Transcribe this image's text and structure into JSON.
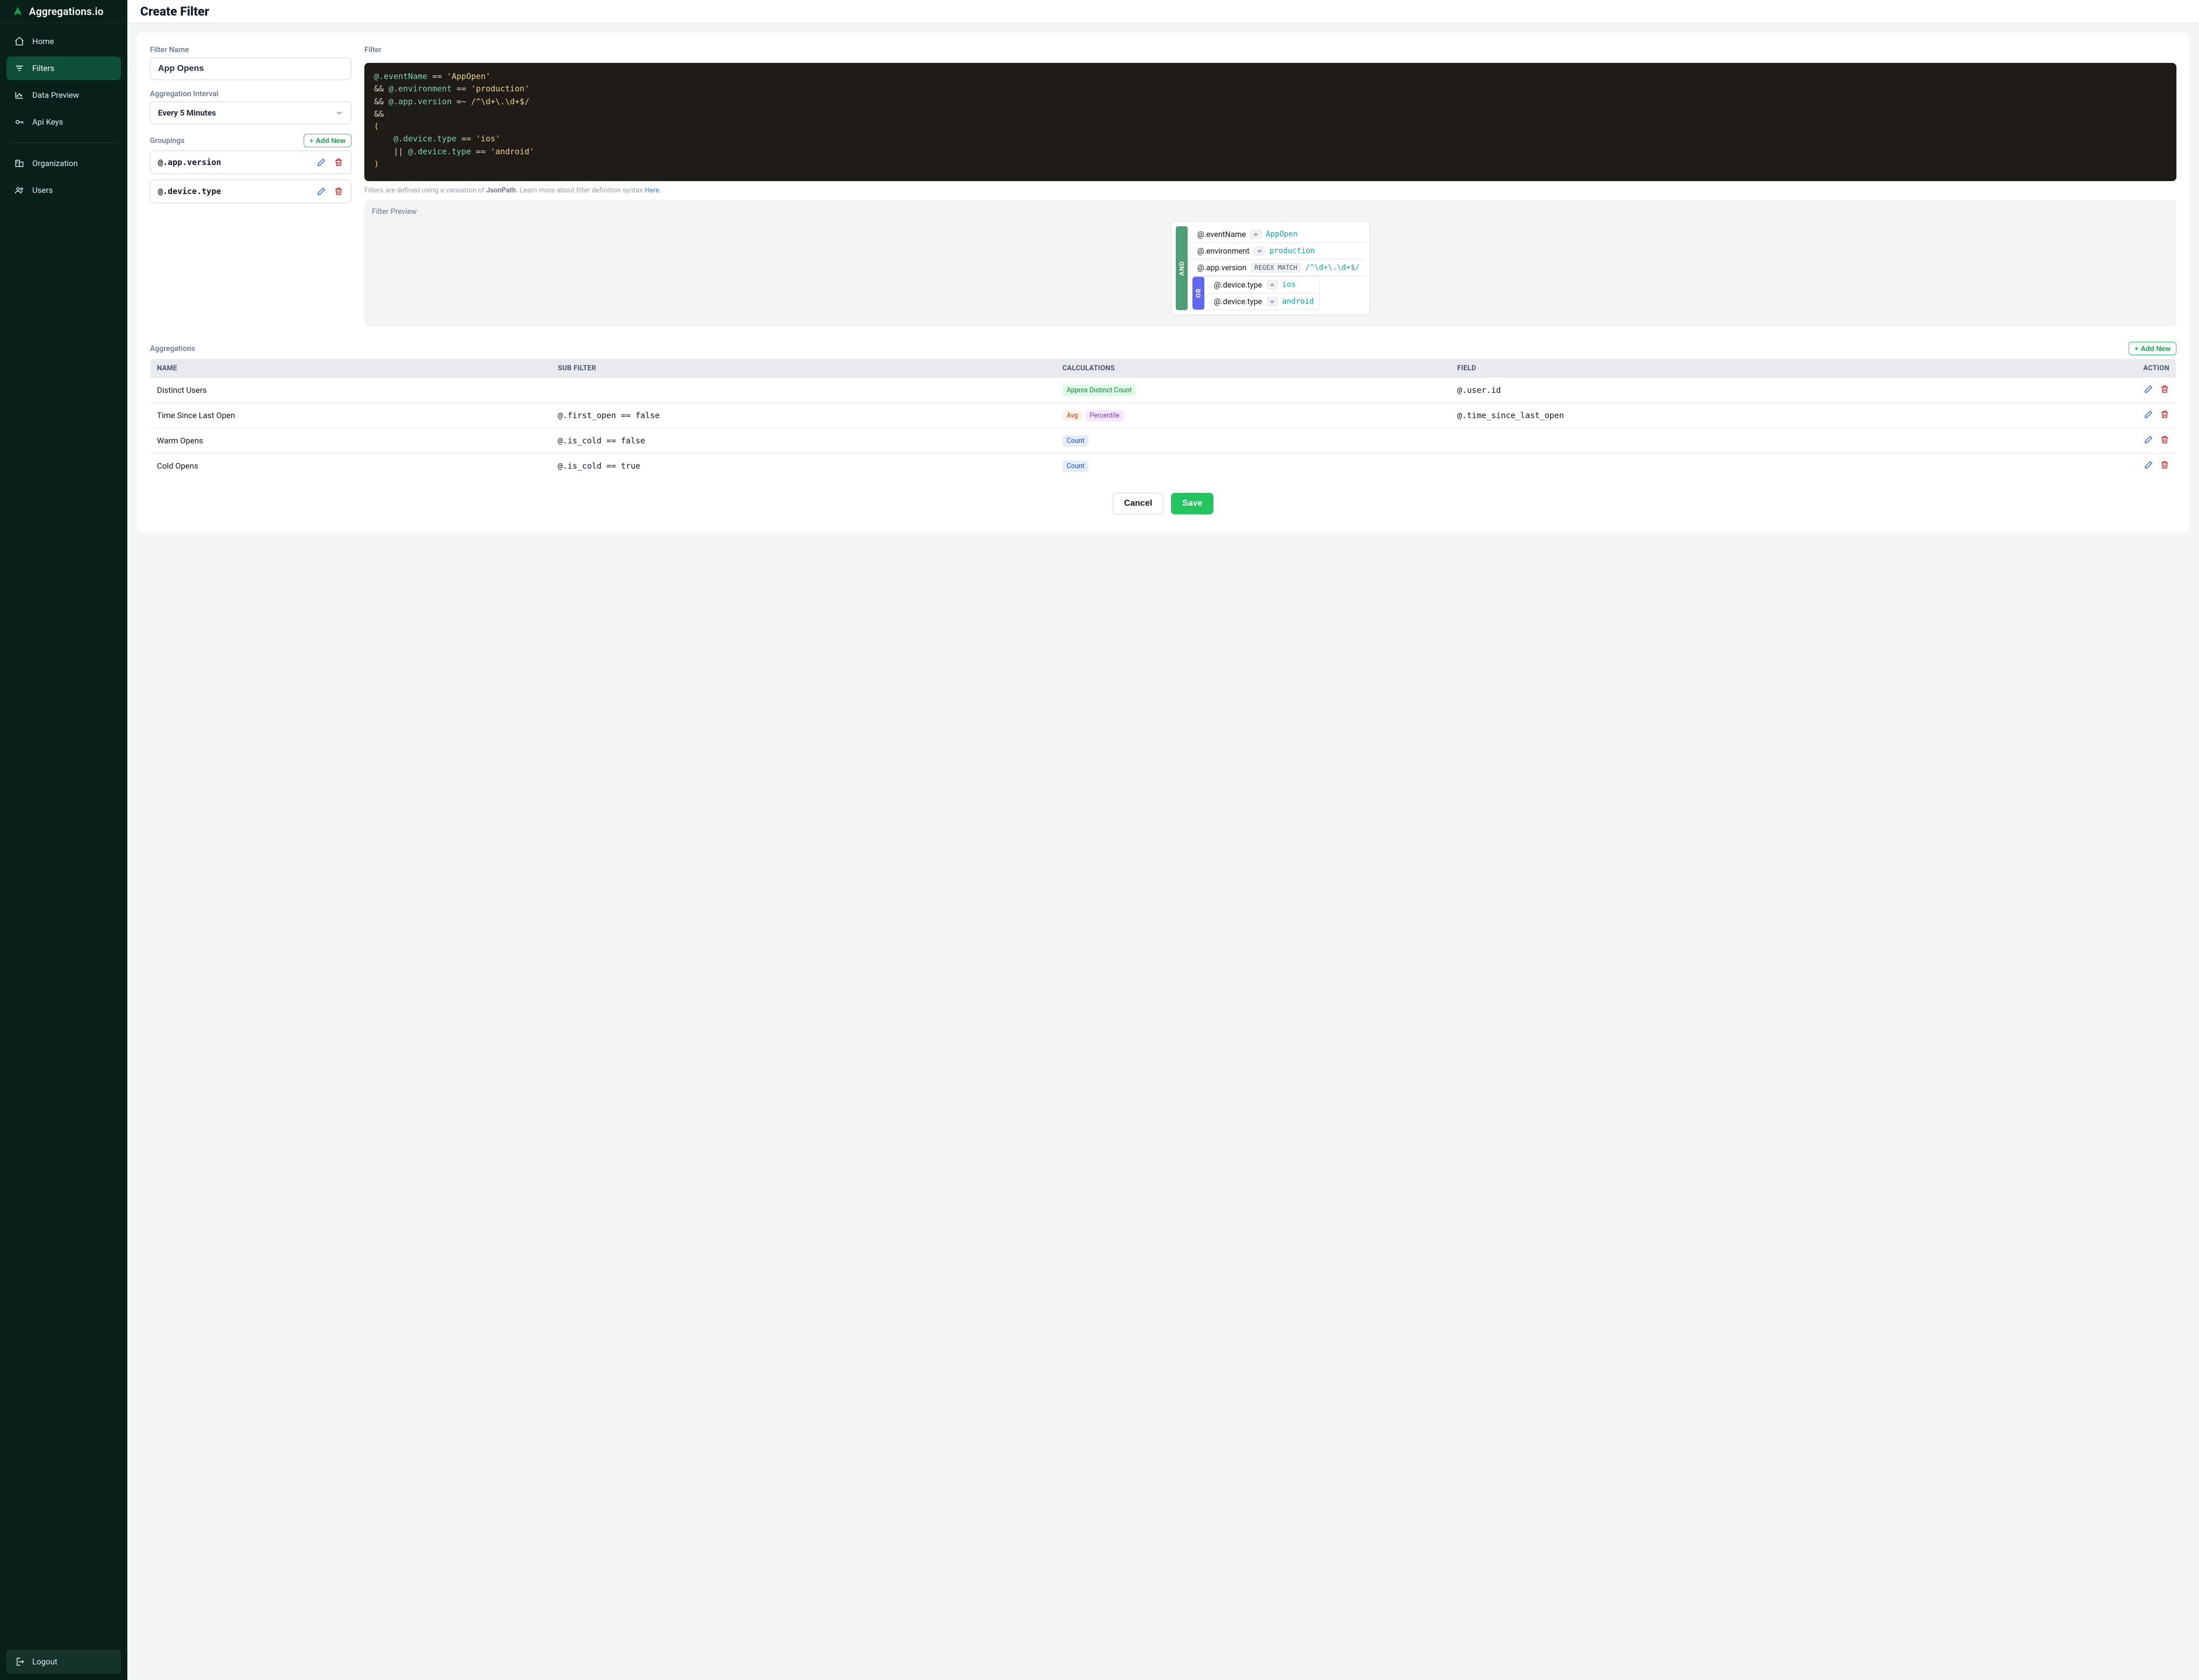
{
  "brand": {
    "name": "Aggregations.io"
  },
  "sidebar": {
    "items": [
      {
        "label": "Home"
      },
      {
        "label": "Filters"
      },
      {
        "label": "Data Preview"
      },
      {
        "label": "Api Keys"
      },
      {
        "label": "Organization"
      },
      {
        "label": "Users"
      }
    ],
    "logout_label": "Logout"
  },
  "page": {
    "title": "Create Filter"
  },
  "form": {
    "filter_name_label": "Filter Name",
    "filter_name_value": "App Opens",
    "interval_label": "Aggregation Interval",
    "interval_value": "Every 5 Minutes",
    "groupings_label": "Groupings",
    "add_new_label": "Add New",
    "groupings": [
      {
        "path": "@.app.version"
      },
      {
        "path": "@.device.type"
      }
    ]
  },
  "filter": {
    "label": "Filter",
    "tokens": {
      "l1_path": "@.eventName",
      "l1_op": "==",
      "l1_str": "'AppOpen'",
      "l2_conj": "&&",
      "l2_path": "@.environment",
      "l2_op": "==",
      "l2_str": "'production'",
      "l3_conj": "&&",
      "l3_path": "@.app.version",
      "l3_op": "=~",
      "l3_regex": "/^\\d+\\.\\d+$/",
      "l4_conj": "&&",
      "l5_open": "(",
      "l6_path": "@.device.type",
      "l6_op": "==",
      "l6_str": "'ios'",
      "l7_conj": "||",
      "l7_path": "@.device.type",
      "l7_op": "==",
      "l7_str": "'android'",
      "l8_close": ")"
    },
    "hint_prefix": "Filters are defined using a varaiation of ",
    "hint_bold": "JsonPath",
    "hint_middle": ". Learn more about filter definition syntax ",
    "hint_link": "Here.",
    "preview_label": "Filter Preview",
    "preview": {
      "and_label": "AND",
      "or_label": "OR",
      "rows_top": [
        {
          "path": "@.eventName",
          "op": "=",
          "value": "AppOpen"
        },
        {
          "path": "@.environment",
          "op": "=",
          "value": "production"
        },
        {
          "path": "@.app.version",
          "op": "REGEX MATCH",
          "value": "/^\\d+\\.\\d+$/"
        }
      ],
      "rows_or": [
        {
          "path": "@.device.type",
          "op": "=",
          "value": "ios"
        },
        {
          "path": "@.device.type",
          "op": "=",
          "value": "android"
        }
      ]
    }
  },
  "aggs": {
    "label": "Aggregations",
    "add_new_label": "Add New",
    "columns": {
      "name": "NAME",
      "sub": "SUB FILTER",
      "calc": "CALCULATIONS",
      "field": "FIELD",
      "action": "ACTION"
    },
    "rows": [
      {
        "name": "Distinct Users",
        "sub": "",
        "chips": [
          {
            "text": "Approx Distinct Count",
            "cls": "chip-green"
          }
        ],
        "field": "@.user.id"
      },
      {
        "name": "Time Since Last Open",
        "sub": "@.first_open == false",
        "chips": [
          {
            "text": "Avg",
            "cls": "chip-orange"
          },
          {
            "text": "Percentile",
            "cls": "chip-purple"
          }
        ],
        "field": "@.time_since_last_open"
      },
      {
        "name": "Warm Opens",
        "sub": "@.is_cold == false",
        "chips": [
          {
            "text": "Count",
            "cls": "chip-blue"
          }
        ],
        "field": ""
      },
      {
        "name": "Cold Opens",
        "sub": "@.is_cold == true",
        "chips": [
          {
            "text": "Count",
            "cls": "chip-blue"
          }
        ],
        "field": ""
      }
    ]
  },
  "footer": {
    "cancel": "Cancel",
    "save": "Save"
  }
}
